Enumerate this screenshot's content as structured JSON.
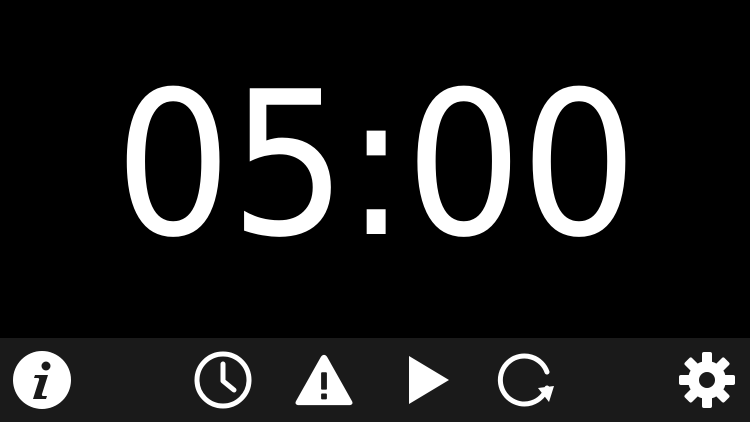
{
  "timer": {
    "display": "05:00"
  },
  "toolbar": {
    "buttons": [
      {
        "id": "info",
        "icon": "info-icon"
      },
      {
        "id": "time",
        "icon": "clock-icon"
      },
      {
        "id": "alert",
        "icon": "warning-icon"
      },
      {
        "id": "play",
        "icon": "play-icon"
      },
      {
        "id": "reset",
        "icon": "reset-icon"
      },
      {
        "id": "settings",
        "icon": "gear-icon"
      }
    ]
  },
  "colors": {
    "background": "#000000",
    "toolbar": "#1a1a1a",
    "foreground": "#ffffff"
  }
}
